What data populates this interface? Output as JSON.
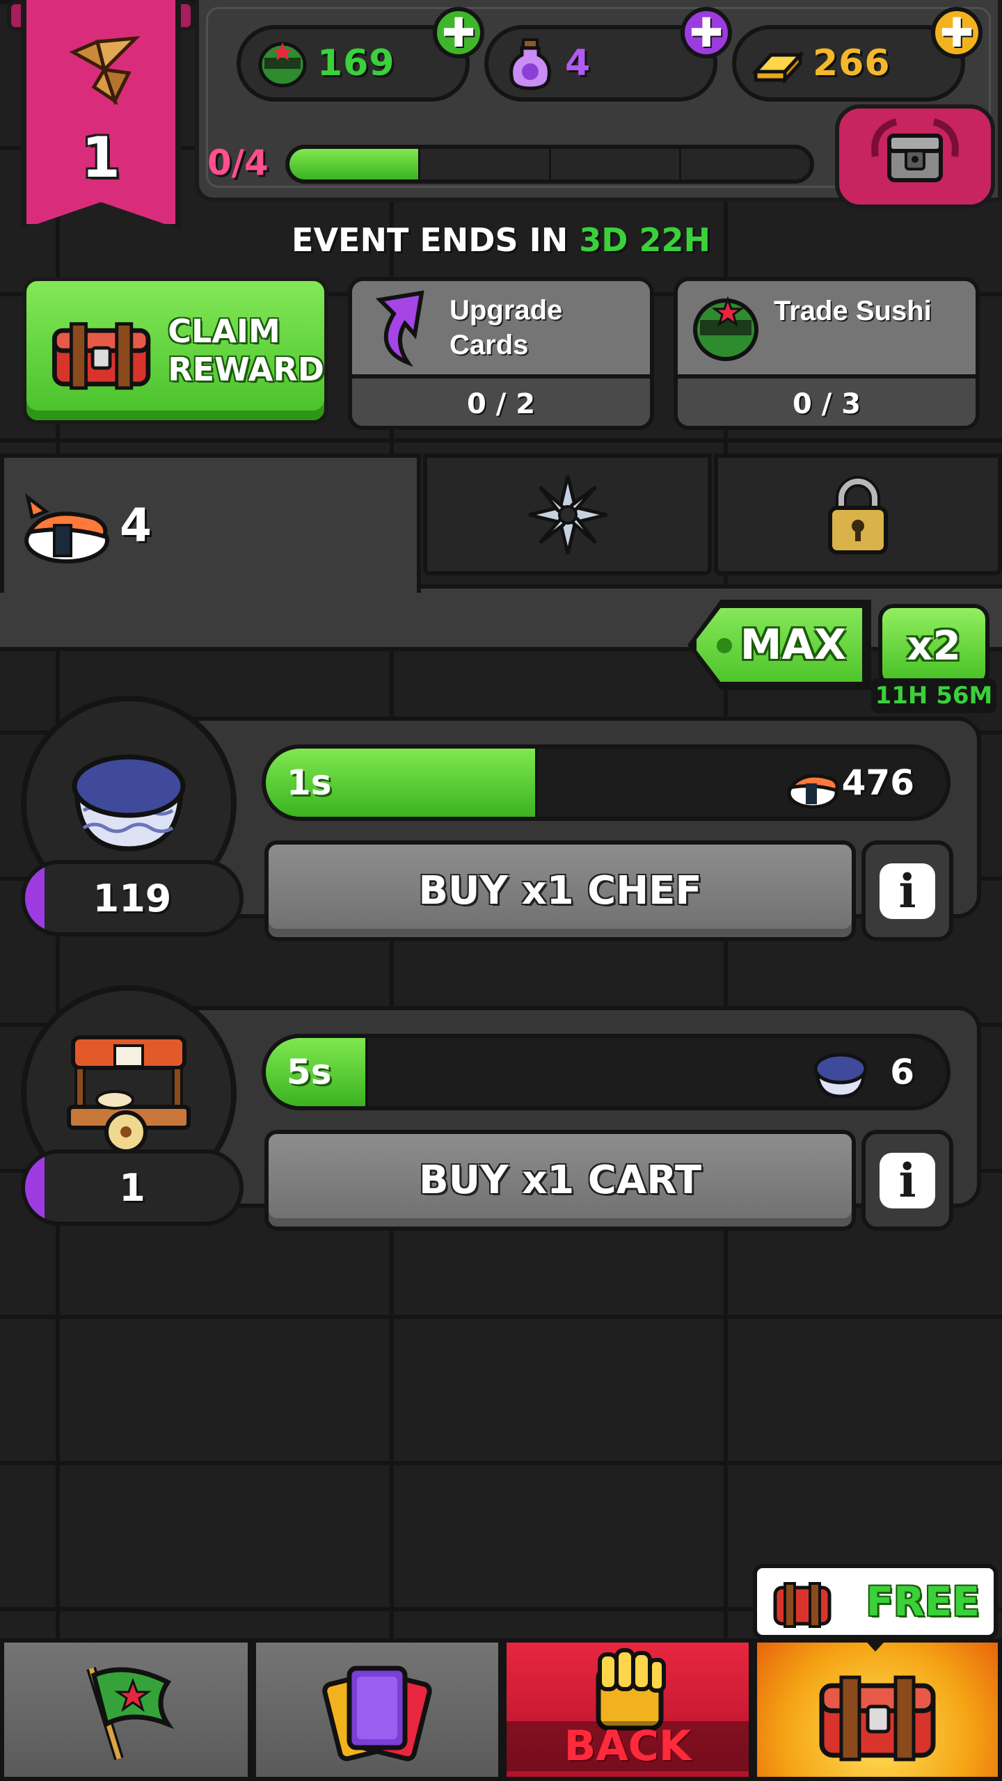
{
  "header": {
    "level": "1",
    "resources": [
      {
        "name": "ninja-token",
        "value": "169",
        "color": "#3ad13a",
        "plus_color": "#3fb52a"
      },
      {
        "name": "potion",
        "value": "4",
        "color": "#b25bf0",
        "plus_color": "#9c3ce0"
      },
      {
        "name": "gold",
        "value": "266",
        "color": "#f5b82a",
        "plus_color": "#f2b21e"
      }
    ],
    "plus_symbol": "✚",
    "xp_text": "0/4",
    "xp_progress": 0.25
  },
  "event": {
    "label": "EVENT ENDS IN",
    "days": "3D",
    "hours": "22H"
  },
  "tasks": {
    "claim": {
      "line1": "CLAIM",
      "line2": "REWARD"
    },
    "upgrade": {
      "line1": "Upgrade",
      "line2": "Cards",
      "progress": "0 / 2"
    },
    "trade": {
      "label": "Trade Sushi",
      "progress": "0 / 3"
    }
  },
  "tabs": {
    "sushi_count": "4"
  },
  "boost": {
    "max_label": "MAX",
    "multiplier_label": "x2",
    "timer": "11H 56M"
  },
  "generators": [
    {
      "name": "chef",
      "owned": "119",
      "time": "1s",
      "progress": 0.4,
      "yield": "476",
      "buy_label": "BUY x1 CHEF"
    },
    {
      "name": "cart",
      "owned": "1",
      "time": "5s",
      "progress": 0.15,
      "yield": "6",
      "buy_label": "BUY x1 CART"
    }
  ],
  "info_symbol": "i",
  "nav": {
    "back_label": "BACK",
    "free_label": "FREE"
  }
}
